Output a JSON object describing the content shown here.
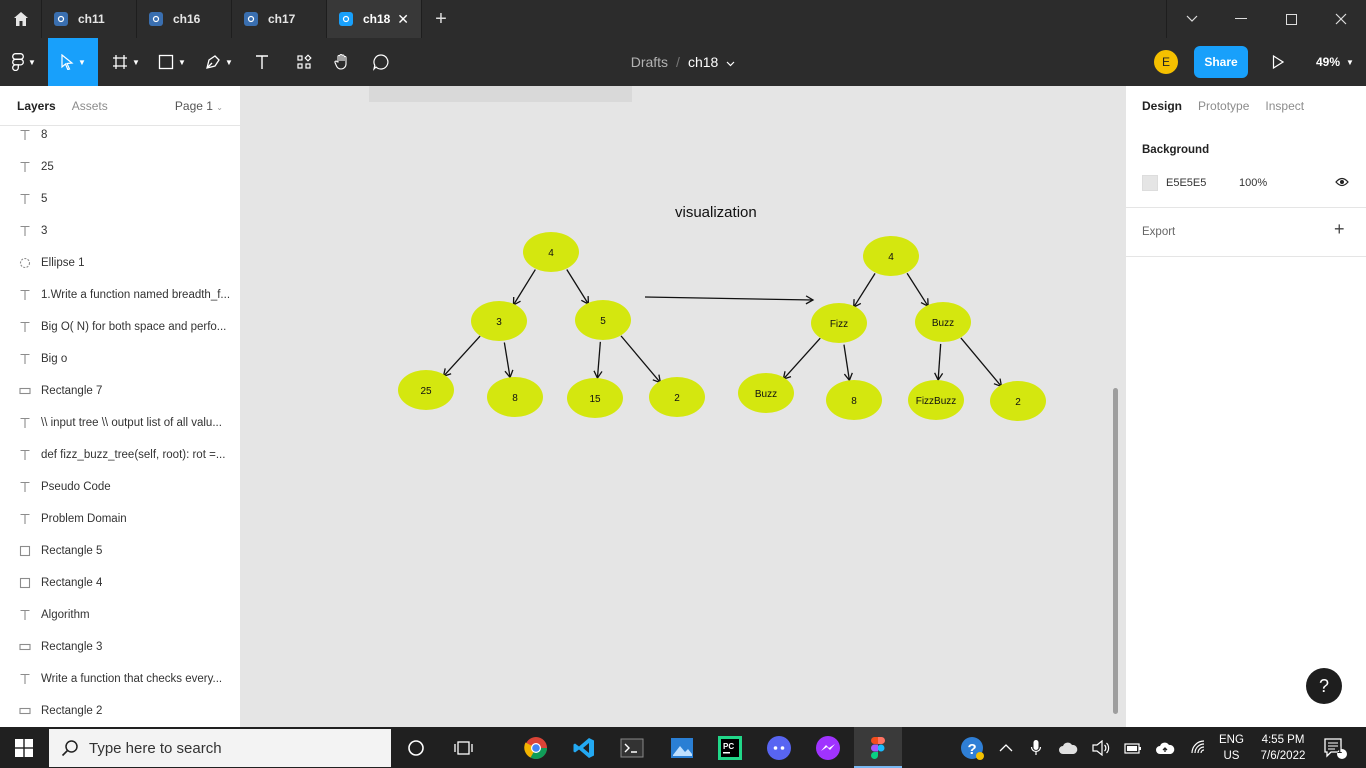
{
  "tabs": [
    {
      "label": "ch11",
      "active": false
    },
    {
      "label": "ch16",
      "active": false
    },
    {
      "label": "ch17",
      "active": false
    },
    {
      "label": "ch18",
      "active": true
    }
  ],
  "toolbar": {
    "breadcrumb_parent": "Drafts",
    "breadcrumb_sep": "/",
    "file_name": "ch18",
    "avatar_initial": "E",
    "share_label": "Share",
    "zoom": "49%"
  },
  "left_panel": {
    "tab_layers": "Layers",
    "tab_assets": "Assets",
    "page": "Page 1",
    "layers": [
      {
        "type": "text",
        "name": "8"
      },
      {
        "type": "text",
        "name": "25"
      },
      {
        "type": "text",
        "name": "5"
      },
      {
        "type": "text",
        "name": "3"
      },
      {
        "type": "ellipse",
        "name": "Ellipse 1"
      },
      {
        "type": "text",
        "name": "1.Write a function named breadth_f..."
      },
      {
        "type": "text",
        "name": "Big O( N) for both space and perfo..."
      },
      {
        "type": "text",
        "name": "Big o"
      },
      {
        "type": "rect-flat",
        "name": "Rectangle 7"
      },
      {
        "type": "text",
        "name": "\\\\ input tree \\\\ output list of all valu..."
      },
      {
        "type": "text",
        "name": "def fizz_buzz_tree(self, root): rot =..."
      },
      {
        "type": "text",
        "name": "Pseudo Code"
      },
      {
        "type": "text",
        "name": "Problem Domain"
      },
      {
        "type": "rect",
        "name": "Rectangle 5"
      },
      {
        "type": "rect",
        "name": "Rectangle 4"
      },
      {
        "type": "text",
        "name": "Algorithm"
      },
      {
        "type": "rect-flat",
        "name": "Rectangle 3"
      },
      {
        "type": "text",
        "name": "Write a function that checks every..."
      },
      {
        "type": "rect-flat",
        "name": "Rectangle 2"
      }
    ]
  },
  "canvas": {
    "title": "visualization",
    "node_color": "#d4e70f",
    "left_tree": [
      "4",
      "3",
      "5",
      "25",
      "8",
      "15",
      "2"
    ],
    "right_tree": [
      "4",
      "Fizz",
      "Buzz",
      "Buzz",
      "8",
      "FizzBuzz",
      "2"
    ]
  },
  "right_panel": {
    "tab_design": "Design",
    "tab_prototype": "Prototype",
    "tab_inspect": "Inspect",
    "background_label": "Background",
    "background_hex": "E5E5E5",
    "background_opacity": "100%",
    "export_label": "Export",
    "help_label": "?"
  },
  "taskbar": {
    "search_placeholder": "Type here to search",
    "lang_1": "ENG",
    "lang_2": "US",
    "time": "4:55 PM",
    "date": "7/6/2022",
    "notification_count": "1"
  },
  "colors": {
    "accent": "#18a0fb",
    "dark_chrome": "#2c2c2c",
    "canvas_bg": "#e5e5e5"
  }
}
